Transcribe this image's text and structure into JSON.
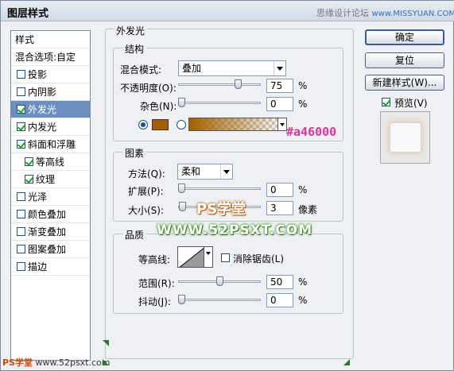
{
  "window": {
    "title": "图层样式",
    "watermark_site": "思缘设计论坛",
    "watermark_url": "www.MISSYUAN.COM"
  },
  "left_panel": {
    "header": "样式",
    "items": [
      {
        "label": "混合选项:自定",
        "checkbox": false,
        "checked": false
      },
      {
        "label": "投影",
        "checkbox": true,
        "checked": false
      },
      {
        "label": "内阴影",
        "checkbox": true,
        "checked": false
      },
      {
        "label": "外发光",
        "checkbox": true,
        "checked": true,
        "selected": true
      },
      {
        "label": "内发光",
        "checkbox": true,
        "checked": true
      },
      {
        "label": "斜面和浮雕",
        "checkbox": true,
        "checked": true
      },
      {
        "label": "等高线",
        "checkbox": true,
        "checked": true,
        "indent": true
      },
      {
        "label": "纹理",
        "checkbox": true,
        "checked": true,
        "indent": true
      },
      {
        "label": "光泽",
        "checkbox": true,
        "checked": false
      },
      {
        "label": "颜色叠加",
        "checkbox": true,
        "checked": false
      },
      {
        "label": "渐变叠加",
        "checkbox": true,
        "checked": false
      },
      {
        "label": "图案叠加",
        "checkbox": true,
        "checked": false
      },
      {
        "label": "描边",
        "checkbox": true,
        "checked": false
      }
    ]
  },
  "outer_glow": {
    "section_title": "外发光",
    "structure": {
      "title": "结构",
      "blend_mode_label": "混合模式:",
      "blend_mode_value": "叠加",
      "opacity_label": "不透明度(O):",
      "opacity_value": "75",
      "opacity_fraction": 0.75,
      "noise_label": "杂色(N):",
      "noise_value": "0",
      "noise_fraction": 0.0,
      "percent": "%",
      "glow_color": "#a46000",
      "color_mode": "solid"
    },
    "elements": {
      "title": "图素",
      "technique_label": "方法(Q):",
      "technique_value": "柔和",
      "spread_label": "扩展(P):",
      "spread_value": "0",
      "spread_fraction": 0.0,
      "size_label": "大小(S):",
      "size_value": "3",
      "size_fraction": 0.015,
      "size_unit": "像素",
      "percent": "%"
    },
    "quality": {
      "title": "品质",
      "contour_label": "等高线:",
      "anti_alias_label": "消除锯齿(L)",
      "anti_alias_checked": false,
      "range_label": "范围(R):",
      "range_value": "50",
      "range_fraction": 0.5,
      "jitter_label": "抖动(J):",
      "jitter_value": "0",
      "jitter_fraction": 0.0,
      "percent": "%"
    }
  },
  "buttons": {
    "ok": "确定",
    "reset": "复位",
    "new_style": "新建样式(W)...",
    "preview_label": "预览(V)",
    "preview_checked": true
  },
  "overlays": {
    "hex_label": "#a46000",
    "ps_brand": "PS学堂",
    "site_url": "WWW.52PSXT.COM",
    "bottom_brand": "PS学堂",
    "bottom_url": "www.52psxt.com"
  }
}
